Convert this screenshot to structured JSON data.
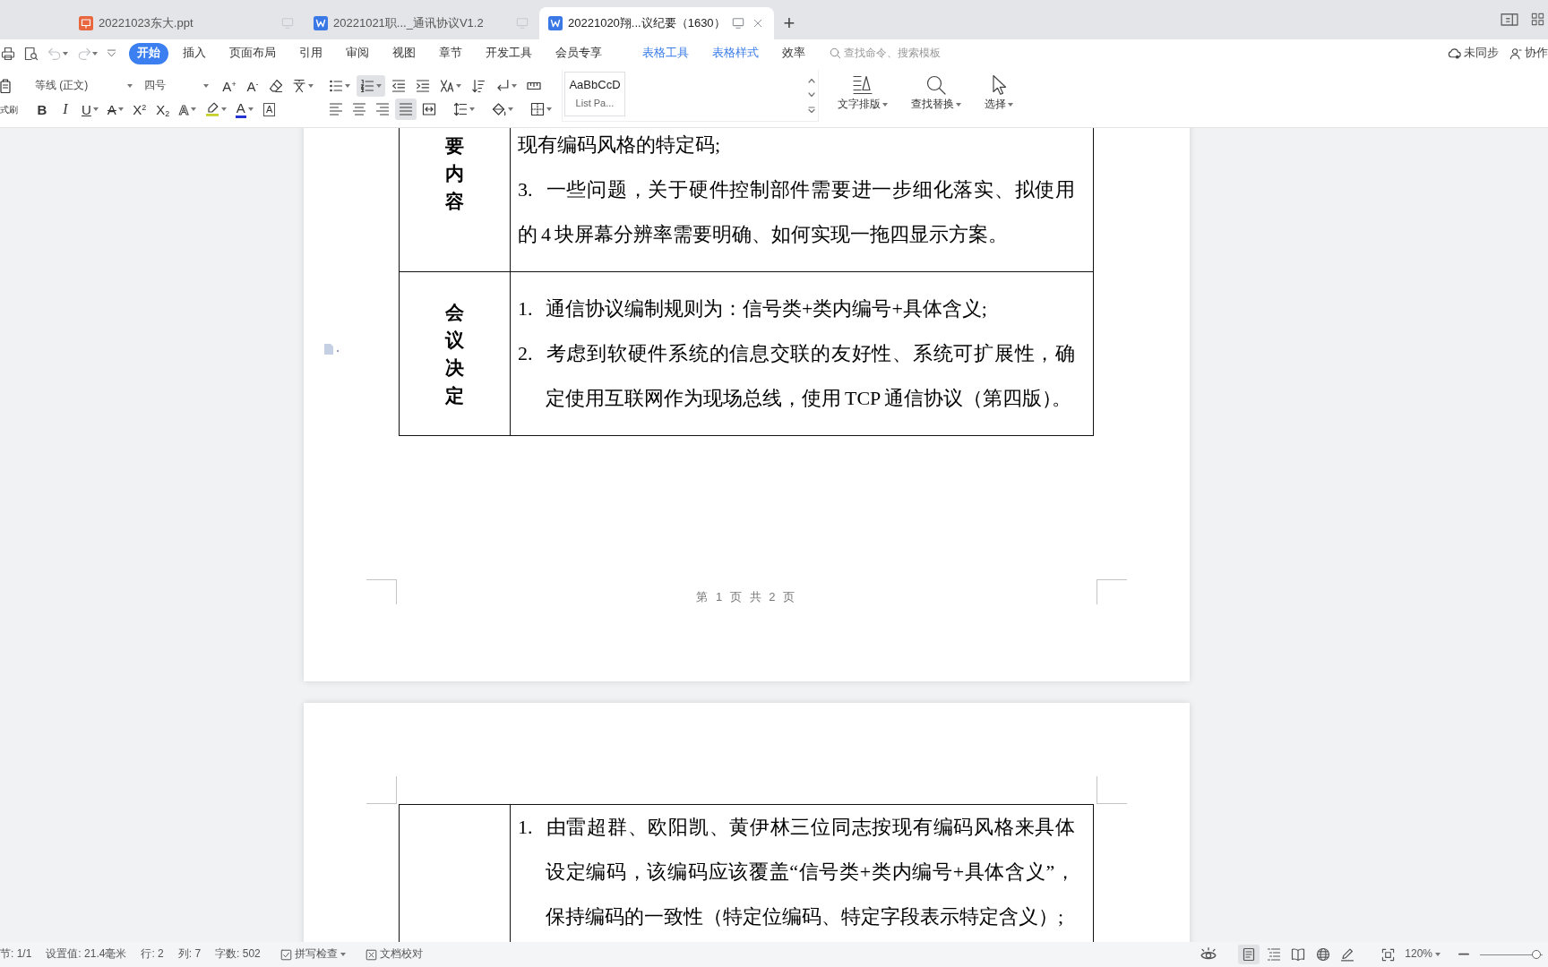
{
  "tabs": [
    {
      "kind": "presentation",
      "title": "20221023东大.ppt",
      "selected": false
    },
    {
      "kind": "document",
      "title": "20221021职..._通讯协议V1.2",
      "selected": false
    },
    {
      "kind": "document",
      "title": "20221020翔...议纪要（1630）",
      "selected": true
    }
  ],
  "new_tab": "+",
  "quick_access": [
    {
      "kind": "print",
      "disabled": false
    },
    {
      "kind": "preview",
      "disabled": false
    },
    {
      "kind": "undo",
      "disabled": true
    },
    {
      "kind": "redo",
      "disabled": true
    },
    {
      "kind": "customize",
      "disabled": false
    }
  ],
  "menu": [
    {
      "label": "开始",
      "kind": "main",
      "selected": true
    },
    {
      "label": "插入",
      "kind": "main",
      "selected": false
    },
    {
      "label": "页面布局",
      "kind": "main",
      "selected": false
    },
    {
      "label": "引用",
      "kind": "main",
      "selected": false
    },
    {
      "label": "审阅",
      "kind": "main",
      "selected": false
    },
    {
      "label": "视图",
      "kind": "main",
      "selected": false
    },
    {
      "label": "章节",
      "kind": "main",
      "selected": false
    },
    {
      "label": "开发工具",
      "kind": "main",
      "selected": false
    },
    {
      "label": "会员专享",
      "kind": "main",
      "selected": false
    },
    {
      "label": "表格工具",
      "kind": "context",
      "selected": false
    },
    {
      "label": "表格样式",
      "kind": "context",
      "selected": false
    },
    {
      "label": "效率",
      "kind": "main",
      "selected": false
    }
  ],
  "command_search": {
    "placeholder": "查找命令、搜索模板"
  },
  "sync_status": "未同步",
  "collaborate": "协作",
  "ribbon": {
    "format_painter": "式刷",
    "font_name": "等线 (正文)",
    "font_size": "四号",
    "font_row1": [
      {
        "kind": "grow",
        "glyph": "A$^{+}$",
        "dropdown": false
      },
      {
        "kind": "shrink",
        "glyph": "A$^{-}$",
        "dropdown": false
      },
      {
        "kind": "clear",
        "dropdown": false
      },
      {
        "kind": "pinyin",
        "dropdown": true
      }
    ],
    "font_row2": [
      {
        "kind": "bold",
        "glyph": "B",
        "dropdown": false
      },
      {
        "kind": "italic",
        "glyph": "I",
        "dropdown": false
      },
      {
        "kind": "underline",
        "glyph": "U",
        "dropdown": true
      },
      {
        "kind": "strike",
        "glyph": "A",
        "dropdown": true
      },
      {
        "kind": "superscript",
        "glyph": "X$^{2}$",
        "dropdown": false
      },
      {
        "kind": "subscript",
        "glyph": "X$_{2}$",
        "dropdown": false
      },
      {
        "kind": "effect",
        "glyph": "A",
        "dropdown": true
      },
      {
        "kind": "highlight",
        "dropdown": true
      },
      {
        "kind": "color",
        "glyph": "A",
        "dropdown": true
      },
      {
        "kind": "border",
        "glyph": "A",
        "dropdown": false
      }
    ],
    "paragraph_row1": [
      {
        "kind": "bullets",
        "dropdown": true,
        "selected": false
      },
      {
        "kind": "numbering",
        "dropdown": true,
        "selected": true
      },
      {
        "kind": "outdent",
        "dropdown": false,
        "selected": false
      },
      {
        "kind": "indent",
        "dropdown": false,
        "selected": false
      },
      {
        "kind": "asian",
        "dropdown": true,
        "selected": false
      },
      {
        "kind": "sort",
        "dropdown": false,
        "selected": false
      },
      {
        "kind": "marks",
        "dropdown": true,
        "selected": false
      },
      {
        "kind": "tabstops",
        "dropdown": false,
        "selected": false
      }
    ],
    "paragraph_row2": [
      {
        "kind": "align-left",
        "dropdown": false,
        "selected": false
      },
      {
        "kind": "align-center",
        "dropdown": false,
        "selected": false
      },
      {
        "kind": "align-right",
        "dropdown": false,
        "selected": false
      },
      {
        "kind": "justify",
        "dropdown": false,
        "selected": true
      },
      {
        "kind": "distribute",
        "dropdown": false,
        "selected": false
      },
      {
        "kind": "line-spacing",
        "dropdown": true,
        "selected": false
      },
      {
        "kind": "shading",
        "dropdown": true,
        "selected": false
      },
      {
        "kind": "borders",
        "dropdown": true,
        "selected": false
      }
    ],
    "style_gallery": {
      "preview": "AaBbCcD",
      "name": "List Pa..."
    },
    "tools": [
      {
        "kind": "text-layout",
        "label": "文字排版"
      },
      {
        "kind": "find",
        "label": "查找替换"
      },
      {
        "kind": "select",
        "label": "选择"
      }
    ]
  },
  "document": {
    "pages": [
      {
        "rows": [
          {
            "label": "要内容",
            "items": [
              {
                "kind": "flush",
                "text": "现有编码风格的特定码;"
              },
              {
                "kind": "flush",
                "number": "3.",
                "text": "一些问题，关于硬件控制部件需要进一步细化落实、拟使用的 4 块屏幕分辨率需要明确、如何实现一拖四显示方案。"
              }
            ]
          },
          {
            "label": "会议决定",
            "items": [
              {
                "kind": "hanging",
                "number": "1.",
                "text": "通信协议编制规则为：信号类+类内编号+具体含义;"
              },
              {
                "kind": "hanging",
                "number": "2.",
                "text": "考虑到软硬件系统的信息交联的友好性、系统可扩展性，确定使用互联网作为现场总线，使用 TCP 通信协议（第四版）。"
              }
            ]
          }
        ],
        "footer": "第 1 页 共 2 页"
      },
      {
        "rows": [
          {
            "items": [
              {
                "kind": "hanging",
                "number": "1.",
                "text": "由雷超群、欧阳凯、黄伊林三位同志按现有编码风格来具体设定编码，该编码应该覆盖“信号类+类内编号+具体含义”，保持编码的一致性（特定位编码、特定字段表示特定含义）;"
              }
            ]
          }
        ]
      }
    ]
  },
  "status_bar": {
    "fields": [
      "节: 1/1",
      "设置值: 21.4毫米",
      "行: 2",
      "列: 7",
      "字数: 502"
    ],
    "spell_check": "拼写检查",
    "proofread": "文档校对",
    "views": [
      {
        "kind": "page",
        "selected": true
      },
      {
        "kind": "outline",
        "selected": false
      },
      {
        "kind": "reading",
        "selected": false
      },
      {
        "kind": "web",
        "selected": false
      },
      {
        "kind": "write",
        "selected": false
      }
    ],
    "zoom": "120%",
    "zoom_slider": {
      "level": 0.97
    }
  }
}
